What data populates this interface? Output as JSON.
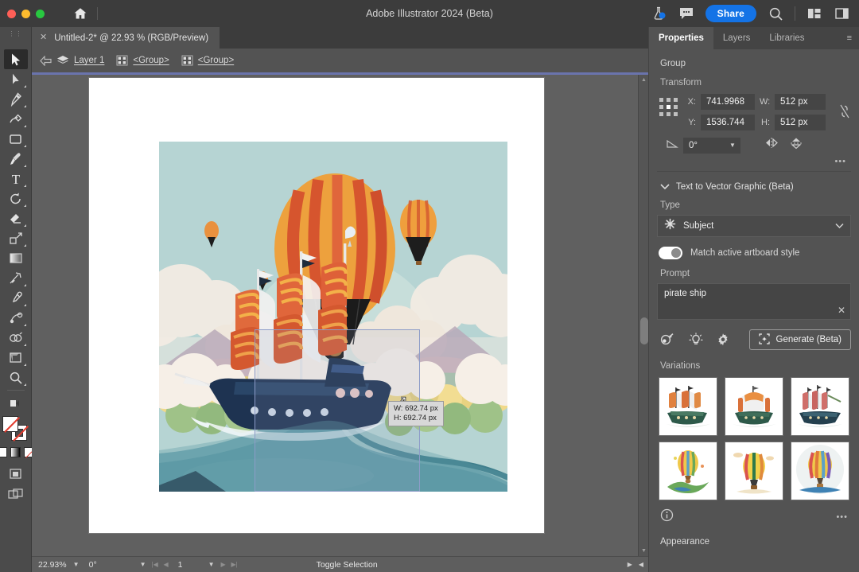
{
  "window": {
    "app_title": "Adobe Illustrator 2024 (Beta)",
    "home_icon": "home-icon",
    "traffic_lights": [
      "close",
      "minimize",
      "maximize"
    ],
    "right_icons": [
      "beaker-icon",
      "comment-icon",
      "search-icon",
      "workspace-grid-icon",
      "panel-layout-icon"
    ],
    "share_label": "Share"
  },
  "document_tab": {
    "label": "Untitled-2* @ 22.93 % (RGB/Preview)",
    "close_icon": "close-icon"
  },
  "breadcrumb": {
    "back_icon": "back-arrow-icon",
    "layers_icon": "layers-icon",
    "items": [
      {
        "label": "Layer 1",
        "icon": "layers-icon"
      },
      {
        "label": "<Group>",
        "icon": "group-icon"
      },
      {
        "label": "<Group>",
        "icon": "group-icon"
      }
    ]
  },
  "toolbar": {
    "grip": "⋮⋮",
    "tools": [
      {
        "name": "selection-tool",
        "active": true
      },
      {
        "name": "direct-selection-tool",
        "active": false
      },
      {
        "name": "pen-tool",
        "active": false
      },
      {
        "name": "curvature-tool",
        "active": false
      },
      {
        "name": "rectangle-tool",
        "active": false
      },
      {
        "name": "paintbrush-tool",
        "active": false
      },
      {
        "name": "type-tool",
        "active": false
      },
      {
        "name": "rotate-tool",
        "active": false
      },
      {
        "name": "eraser-tool",
        "active": false
      },
      {
        "name": "scale-tool",
        "active": false
      },
      {
        "name": "gradient-tool",
        "active": false
      },
      {
        "name": "width-tool",
        "active": false
      },
      {
        "name": "eyedropper-tool",
        "active": false
      },
      {
        "name": "blend-tool",
        "active": false
      },
      {
        "name": "shape-builder-tool",
        "active": false
      },
      {
        "name": "artboard-tool",
        "active": false
      },
      {
        "name": "zoom-tool",
        "active": false
      }
    ],
    "fill_color": "#ffffff",
    "stroke_color": "none",
    "more_tools": "…"
  },
  "canvas": {
    "artboard_background": "#ffffff",
    "selection": {
      "width_label": "W: 692.74 px",
      "height_label": "H: 692.74 px",
      "cursor": "resize-diagonal-cursor"
    },
    "artwork": {
      "title": "hot air balloon and pirate ship landscape",
      "sky_color": "#b6d4d3",
      "cloud_color": "#f6efe7",
      "river_color": "#69a8b4",
      "balloon_colors": [
        "#e8763c",
        "#f2a83c",
        "#d0542f",
        "#1c1c1c"
      ],
      "ship_hull_color": "#1e3351",
      "sail_colors": [
        "#e0663b",
        "#efa council",
        "#f3b149"
      ],
      "tree_colors": [
        "#f0d98a",
        "#9fc288",
        "#7fae8a"
      ]
    },
    "scrollbar": {
      "name": "vertical-scrollbar"
    }
  },
  "statusbar": {
    "zoom": "22.93%",
    "rotation": "0°",
    "page": "1",
    "toggle_label": "Toggle Selection"
  },
  "properties_panel": {
    "tabs": [
      {
        "label": "Properties",
        "active": true
      },
      {
        "label": "Layers",
        "active": false
      },
      {
        "label": "Libraries",
        "active": false
      }
    ],
    "tabs_more": "≡",
    "object_type": "Group",
    "transform": {
      "heading": "Transform",
      "x_label": "X:",
      "x_value": "741.9968",
      "y_label": "Y:",
      "y_value": "1536.744",
      "w_label": "W:",
      "w_value": "512 px",
      "h_label": "H:",
      "h_value": "512 px",
      "angle_value": "0°",
      "link_icon": "link-broken-icon",
      "flip_h_icon": "flip-horizontal-icon",
      "flip_v_icon": "flip-vertical-icon",
      "more_icon": "more-options-icon",
      "reference_point": "center"
    },
    "text_to_vector": {
      "title": "Text to Vector Graphic (Beta)",
      "chevron": "chevron-down-icon",
      "type_label": "Type",
      "type_value": "Subject",
      "type_icon": "subject-icon",
      "match_artboard_label": "Match active artboard style",
      "match_artboard_on": true,
      "prompt_label": "Prompt",
      "prompt_value": "pirate ship",
      "prompt_clear_icon": "close-icon",
      "action_icons": [
        "color-sampler-icon",
        "lightbulb-icon",
        "gear-icon"
      ],
      "generate_label": "Generate (Beta)",
      "generate_icon": "generate-sparkle-icon"
    },
    "variations": {
      "heading": "Variations",
      "items": [
        {
          "name": "variation-pirate-ship-1",
          "kind": "ship"
        },
        {
          "name": "variation-pirate-ship-2",
          "kind": "ship"
        },
        {
          "name": "variation-pirate-ship-3",
          "kind": "ship"
        },
        {
          "name": "variation-balloon-1",
          "kind": "balloon"
        },
        {
          "name": "variation-balloon-2",
          "kind": "balloon"
        },
        {
          "name": "variation-balloon-3",
          "kind": "balloon"
        }
      ],
      "info_icon": "info-icon",
      "more_icon": "more-options-icon"
    },
    "appearance_heading": "Appearance"
  }
}
